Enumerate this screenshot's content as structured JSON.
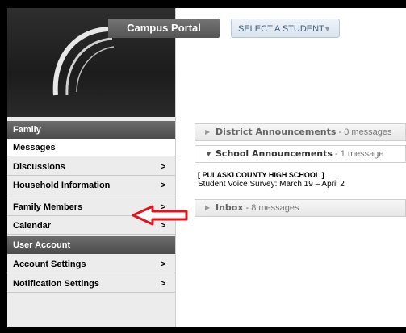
{
  "header": {
    "portal_title": "Campus Portal",
    "select_student_label": "SELECT A STUDENT",
    "select_caret": "▼"
  },
  "sidebar": {
    "sections": [
      {
        "label": "Family"
      },
      {
        "label": "User Account"
      }
    ],
    "items": [
      {
        "label": "Messages",
        "chevron": ""
      },
      {
        "label": "Discussions",
        "chevron": ">"
      },
      {
        "label": "Household Information",
        "chevron": ">"
      },
      {
        "label": "Family Members",
        "chevron": ">"
      },
      {
        "label": "Calendar",
        "chevron": ">"
      },
      {
        "label": "Account Settings",
        "chevron": ">"
      },
      {
        "label": "Notification Settings",
        "chevron": ">"
      }
    ]
  },
  "main": {
    "district": {
      "title": "District Announcements",
      "count": " - 0 messages",
      "tri": "▶"
    },
    "school": {
      "title": "School Announcements",
      "count": " - 1 message",
      "tri": "▼",
      "messages": [
        {
          "school": "[ PULASKI COUNTY HIGH SCHOOL ]",
          "text": "Student Voice Survey: March 19 – April 2"
        }
      ]
    },
    "inbox": {
      "title": "Inbox",
      "count": " - 8 messages",
      "tri": "▶"
    }
  },
  "colors": {
    "annotation_arrow": "#e0141e",
    "nav_header": "#555555",
    "select_text": "#3f5f80"
  }
}
